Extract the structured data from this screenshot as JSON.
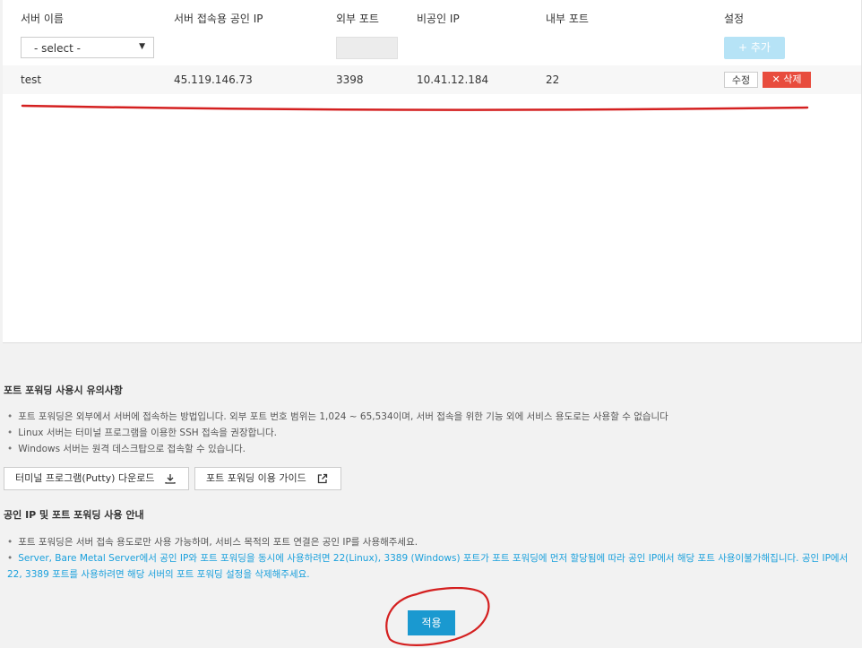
{
  "table": {
    "headers": [
      "서버 이름",
      "서버 접속용 공인 IP",
      "외부 포트",
      "비공인 IP",
      "내부 포트",
      "설정"
    ],
    "select_value": "- select -",
    "add_label": "+ 추가",
    "rows": [
      {
        "name": "test",
        "public_ip": "45.119.146.73",
        "ext_port": "3398",
        "private_ip": "10.41.12.184",
        "int_port": "22"
      }
    ],
    "edit_label": "수정",
    "delete_label": "✕ 삭제"
  },
  "notice1": {
    "title": "포트 포워딩 사용시 유의사항",
    "items": [
      "포트 포워딩은 외부에서 서버에 접속하는 방법입니다. 외부 포트 번호 범위는 1,024 ~ 65,534이며, 서버 접속을 위한 기능 외에 서비스 용도로는 사용할 수 없습니다",
      "Linux 서버는 터미널 프로그램을 이용한 SSH 접속을 권장합니다.",
      "Windows 서버는 원격 데스크탑으로 접속할 수 있습니다."
    ],
    "putty_button": "터미널 프로그램(Putty) 다운로드",
    "guide_button": "포트 포워딩 이용 가이드"
  },
  "notice2": {
    "title": "공인 IP 및 포트 포워딩 사용 안내",
    "items": [
      "포트 포워딩은 서버 접속 용도로만 사용 가능하며, 서비스 목적의 포트 연결은 공인 IP를 사용해주세요.",
      "Server, Bare Metal Server에서 공인 IP와 포트 포워딩을 동시에 사용하려면 22(Linux), 3389 (Windows) 포트가 포트 포워딩에 먼저 할당됨에 따라 공인 IP에서 해당 포트 사용이불가해집니다. 공인 IP에서 22, 3389 포트를 사용하려면 해당 서버의 포트 포워딩 설정을 삭제해주세요."
    ]
  },
  "apply_label": "적용",
  "colors": {
    "accent": "#1a99d0",
    "danger": "#e84c3d",
    "annotation": "#d42020",
    "notice_blue": "#1aa0dc"
  }
}
